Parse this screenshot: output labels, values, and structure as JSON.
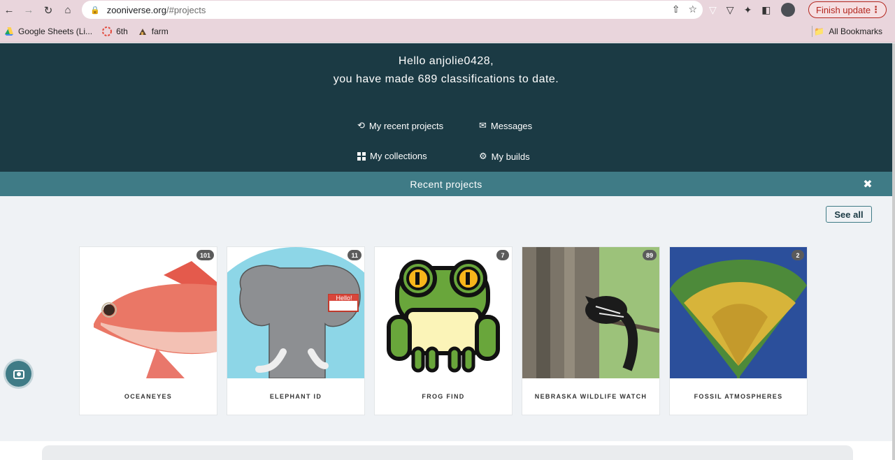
{
  "browser": {
    "url_domain": "zooniverse.org",
    "url_path": "/#projects",
    "finish_update": "Finish update",
    "bookmarks": [
      "Google Sheets (Li...",
      "6th",
      "farm"
    ],
    "all_bookmarks": "All Bookmarks"
  },
  "hero": {
    "greeting": "Hello anjolie0428,",
    "classifications": "you have made 689 classifications to date.",
    "links": {
      "recent": "My recent projects",
      "messages": "Messages",
      "collections": "My collections",
      "builds": "My builds"
    }
  },
  "recent_bar": {
    "title": "Recent projects"
  },
  "see_all": "See all",
  "projects": [
    {
      "name": "OCEANEYES",
      "count": "101"
    },
    {
      "name": "ELEPHANT ID",
      "count": "11"
    },
    {
      "name": "FROG FIND",
      "count": "7"
    },
    {
      "name": "NEBRASKA WILDLIFE WATCH",
      "count": "89"
    },
    {
      "name": "FOSSIL ATMOSPHERES",
      "count": "2"
    }
  ],
  "elephant_sign": "Hello!",
  "colors": {
    "hero": "#1b3a44",
    "accent": "#3f7b86",
    "background": "#eff2f5"
  }
}
